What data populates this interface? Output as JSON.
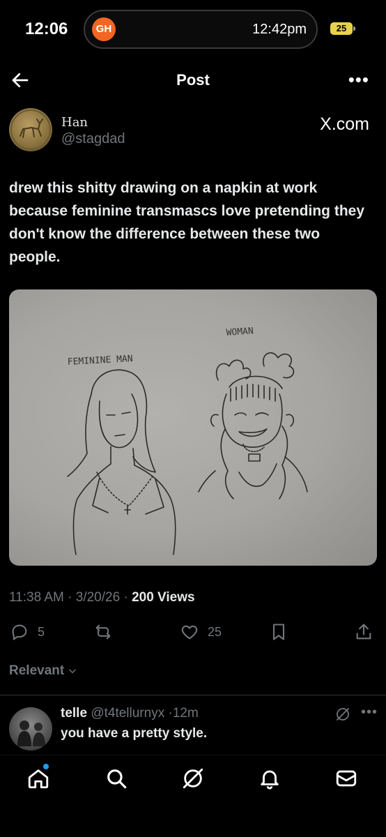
{
  "status_bar": {
    "time": "12:06",
    "app_badge": "GH",
    "pill_time": "12:42pm",
    "battery": "25"
  },
  "header": {
    "title": "Post"
  },
  "author": {
    "name": "Han",
    "handle": "@stagdad",
    "watermark": "X.com"
  },
  "post": {
    "text": "drew this shitty drawing on a napkin at work because feminine transmascs love pretending they don't know the difference between these two people.",
    "image": {
      "label_left": "FEMININE MAN",
      "label_right": "WOMAN"
    },
    "meta": {
      "time": "11:38 AM",
      "date": "3/20/26",
      "views": "200",
      "views_label": "Views"
    },
    "actions": {
      "replies": "5",
      "likes": "25"
    }
  },
  "sort": {
    "label": "Relevant"
  },
  "reply": {
    "name": "telle",
    "handle": "@t4tellurnyx",
    "age": "12m",
    "text": "you have a pretty style."
  },
  "colors": {
    "background": "#000000",
    "muted": "#71767b",
    "text": "#e7e9ea",
    "accent": "#1d9bf0"
  }
}
